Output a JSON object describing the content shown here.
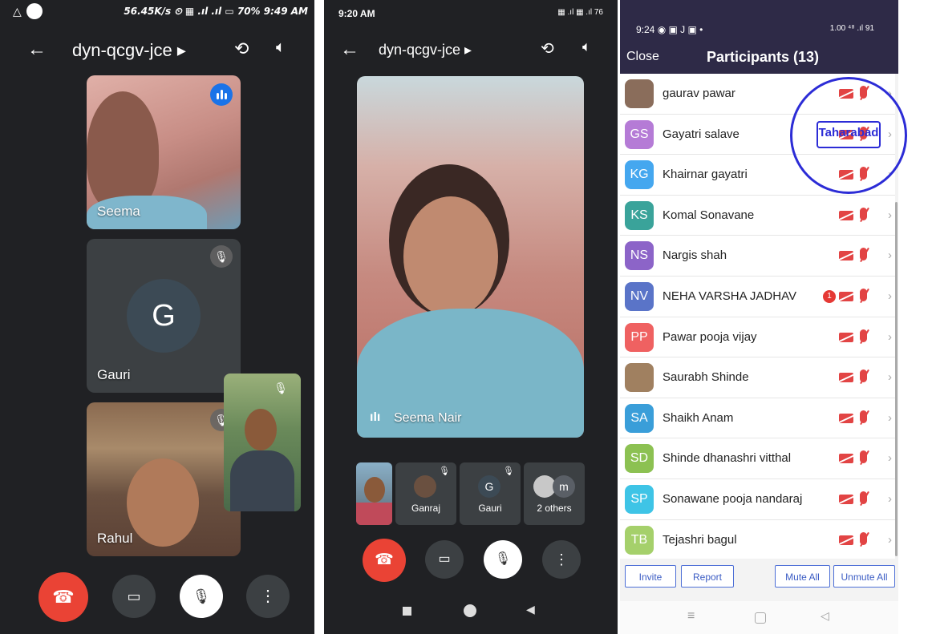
{
  "left_call": {
    "status_bar": {
      "right": "56.45K/s ⏲ ▦ .ıl .ıl ▭ 70% 9:49 AM",
      "left_icons": [
        "warning-icon",
        "whatsapp-icon"
      ]
    },
    "top_bar": {
      "title": "dyn-qcgv-jce ▸"
    },
    "tiles": [
      {
        "name": "Seema"
      },
      {
        "name": "Gauri",
        "initial": "G"
      },
      {
        "name": "Rahul"
      }
    ],
    "controls": [
      "hang-up",
      "camera",
      "mic-off",
      "more"
    ]
  },
  "middle_call": {
    "status_bar": {
      "time": "9:20 AM",
      "right": "▦ .ıl ▦ .ıl 76"
    },
    "top_bar": {
      "title": "dyn-qcgv-jce ▸"
    },
    "main_speaker": {
      "name": "Seema Nair"
    },
    "thumbnails": [
      {
        "label": ""
      },
      {
        "label": "Ganraj"
      },
      {
        "label": "Gauri",
        "initial": "G"
      },
      {
        "label": "2 others",
        "initial": "m"
      }
    ]
  },
  "participants_panel": {
    "status_bar": {
      "time": "9:24 ◉ ▣ J ▣ •",
      "right": "1.00 ⁴⁸ .ıl 91"
    },
    "close_label": "Close",
    "title": "Participants (13)",
    "participants": [
      {
        "initials": "",
        "name": "gaurav pawar",
        "color": "#8a6d5b",
        "photo": true
      },
      {
        "initials": "GS",
        "name": "Gayatri salave",
        "color": "#b57bd6"
      },
      {
        "initials": "KG",
        "name": "Khairnar gayatri",
        "color": "#45a7ef"
      },
      {
        "initials": "KS",
        "name": "Komal Sonavane",
        "color": "#3aa39a"
      },
      {
        "initials": "NS",
        "name": "Nargis shah",
        "color": "#8c64c8"
      },
      {
        "initials": "NV",
        "name": "NEHA VARSHA JADHAV",
        "color": "#5a74c8",
        "badge": "1"
      },
      {
        "initials": "PP",
        "name": "Pawar pooja vijay",
        "color": "#ef6161"
      },
      {
        "initials": "",
        "name": "Saurabh Shinde",
        "color": "#a08060",
        "photo": true
      },
      {
        "initials": "SA",
        "name": "Shaikh Anam",
        "color": "#3a9ed9"
      },
      {
        "initials": "SD",
        "name": "Shinde dhanashri vitthal",
        "color": "#8cc152"
      },
      {
        "initials": "SP",
        "name": "Sonawane pooja nandaraj",
        "color": "#3ec4e6"
      },
      {
        "initials": "TB",
        "name": "Tejashri bagul",
        "color": "#a5d06b"
      }
    ],
    "buttons": {
      "invite": "Invite",
      "report": "Report",
      "mute_all": "Mute All",
      "unmute_all": "Unmute All"
    },
    "stamp_text": "Taharabad"
  },
  "colors": {
    "meet_bg": "#202124",
    "hangup": "#ea4335",
    "zoom_header": "#2e2a47",
    "mute_red": "#e24444",
    "accent_blue": "#1a73e8"
  }
}
